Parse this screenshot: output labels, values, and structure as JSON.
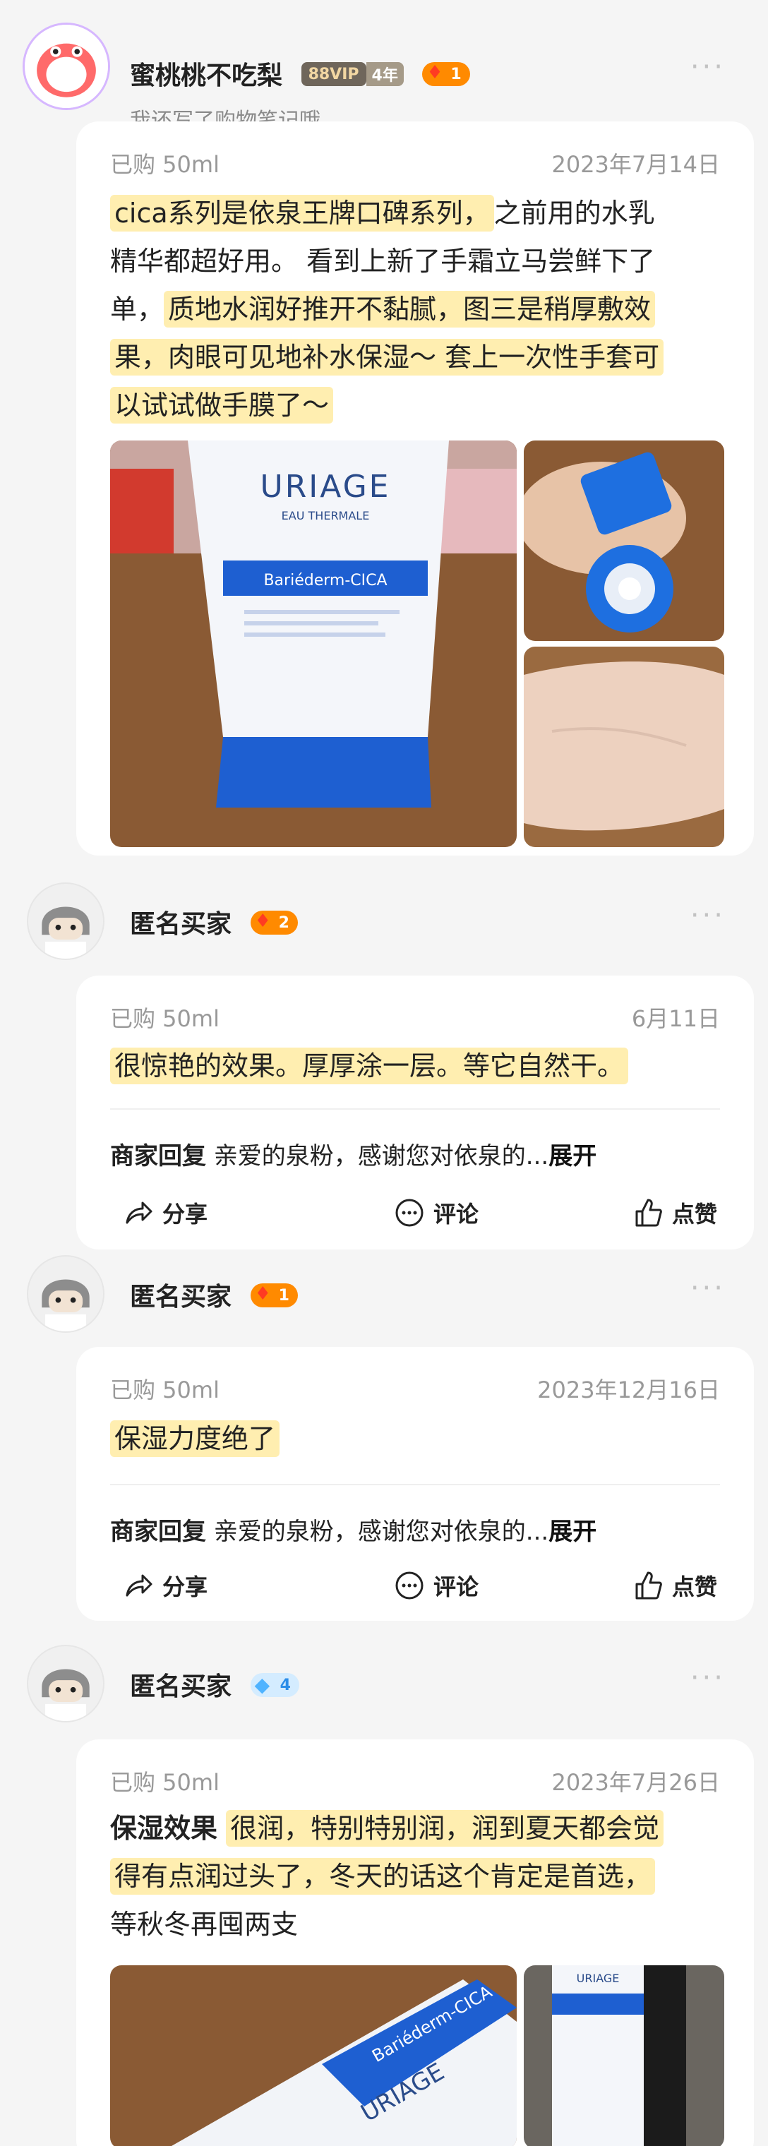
{
  "post1": {
    "username": "蜜桃桃不吃梨",
    "vip_badge": "88VIP",
    "year_badge": "4年",
    "level": "1",
    "subtitle": "我还写了购物笔记哦",
    "purchased": "已购 50ml",
    "date": "2023年7月14日",
    "text_line1_hl": "cica系列是依泉王牌口碑系列，",
    "text_line1_rest": "之前用的水乳",
    "text_line2": "精华都超好用。 看到上新了手霜立马尝鲜下了",
    "text_line3_a": "单，",
    "text_line3_hl": "质地水润好推开不黏腻，图三是稍厚敷效",
    "text_line4_hl": "果，肉眼可见地补水保湿～ 套上一次性手套可",
    "text_line5_hl": "以试试做手膜了～",
    "photo_tube_brand": "URIAGE",
    "photo_tube_sub": "EAU THERMALE",
    "photo_tube_name": "Bariéderm-CICA"
  },
  "post2": {
    "username": "匿名买家",
    "level": "2",
    "purchased": "已购 50ml",
    "date": "6月11日",
    "text": "很惊艳的效果。厚厚涂一层。等它自然干。",
    "reply_label": "商家回复",
    "reply_text": "亲爱的泉粉，感谢您对依泉的...",
    "reply_expand": "展开",
    "share": "分享",
    "comment": "评论",
    "like": "点赞"
  },
  "post3": {
    "username": "匿名买家",
    "level": "1",
    "purchased": "已购 50ml",
    "date": "2023年12月16日",
    "text": "保湿力度绝了",
    "reply_label": "商家回复",
    "reply_text": "亲爱的泉粉，感谢您对依泉的...",
    "reply_expand": "展开",
    "share": "分享",
    "comment": "评论",
    "like": "点赞"
  },
  "post4": {
    "username": "匿名买家",
    "level": "4",
    "purchased": "已购 50ml",
    "date": "2023年7月26日",
    "label": "保湿效果",
    "text_line1_hl": "很润，特别特别润，润到夏天都会觉",
    "text_line2_hl": "得有点润过头了，冬天的话这个肯定是首选，",
    "text_line3": "等秋冬再囤两支",
    "photo_tube_brand": "URIAGE",
    "photo_tube_name": "Bariéderm-CICA"
  },
  "more": "···",
  "colors": {
    "highlight": "#ffeeb0",
    "accent_blue": "#1e5fd1",
    "badge_orange": "#ff8a00"
  }
}
